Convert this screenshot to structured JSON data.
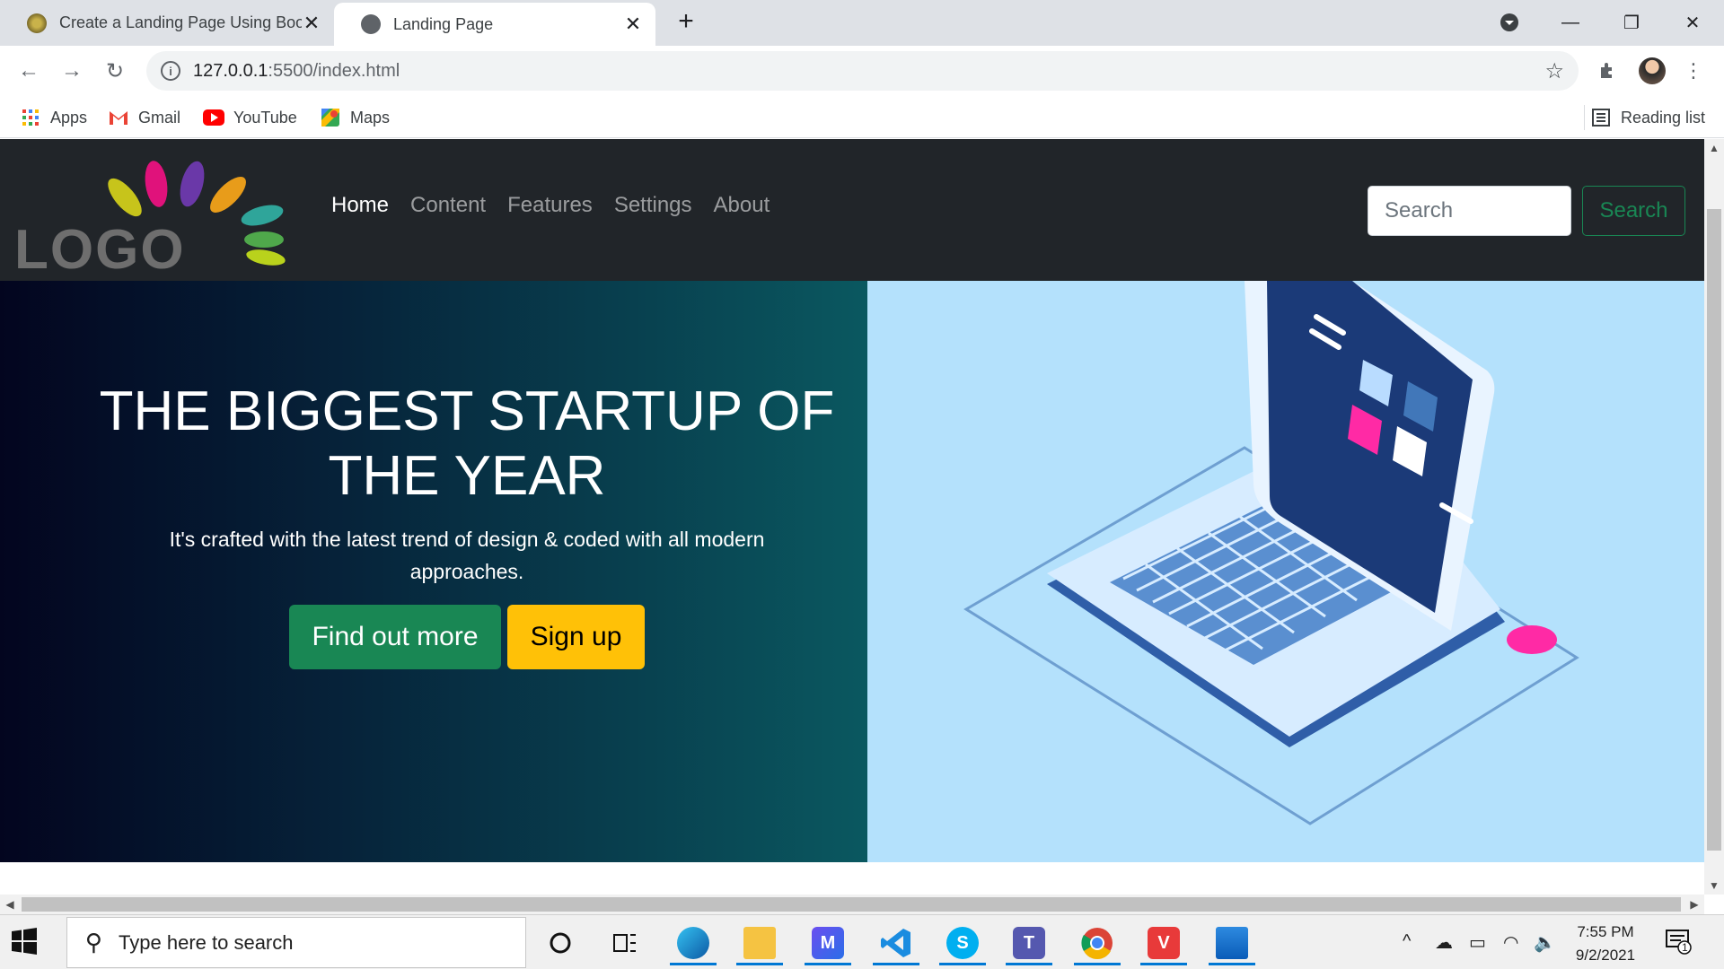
{
  "browser": {
    "tabs": [
      {
        "title": "Create a Landing Page Using Boo",
        "active": false
      },
      {
        "title": "Landing Page",
        "active": true
      }
    ],
    "new_tab": "+",
    "url_host": "127.0.0.1",
    "url_rest": ":5500/index.html",
    "bookmarks": [
      {
        "label": "Apps",
        "icon": "apps-grid-icon"
      },
      {
        "label": "Gmail",
        "icon": "gmail-icon"
      },
      {
        "label": "YouTube",
        "icon": "youtube-icon"
      },
      {
        "label": "Maps",
        "icon": "maps-icon"
      }
    ],
    "reading_list": "Reading list"
  },
  "page": {
    "logo_text": "LOGO",
    "nav": [
      {
        "label": "Home",
        "active": true
      },
      {
        "label": "Content",
        "active": false
      },
      {
        "label": "Features",
        "active": false
      },
      {
        "label": "Settings",
        "active": false
      },
      {
        "label": "About",
        "active": false
      }
    ],
    "search_placeholder": "Search",
    "search_button": "Search",
    "hero": {
      "title": "THE BIGGEST STARTUP OF THE YEAR",
      "subtitle": "It's crafted with the latest trend of design & coded with all modern approaches.",
      "primary_button": "Find out more",
      "secondary_button": "Sign up"
    }
  },
  "taskbar": {
    "search_placeholder": "Type here to search",
    "time": "7:55 PM",
    "date": "9/2/2021",
    "notification_count": "1"
  },
  "colors": {
    "navbar": "#212529",
    "hero_right": "#b4e1fc",
    "btn_success": "#198754",
    "btn_warning": "#ffc107"
  }
}
